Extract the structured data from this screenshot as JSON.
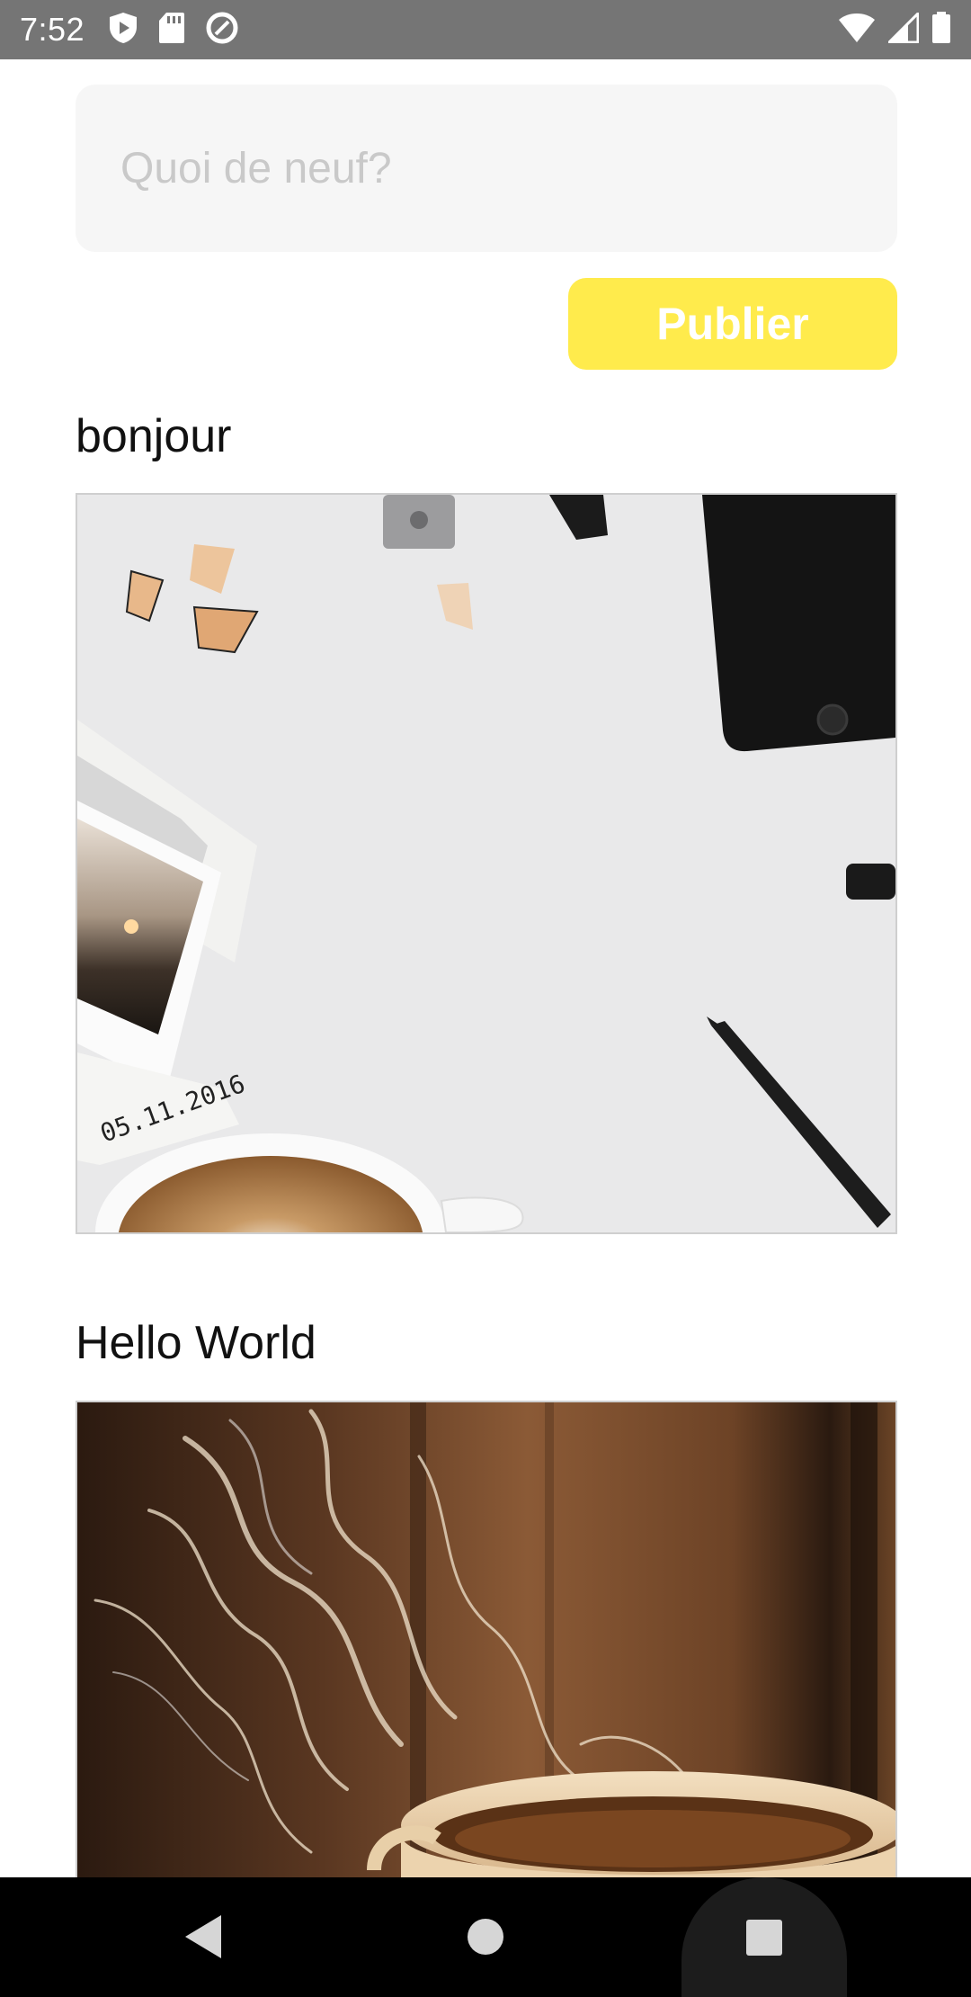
{
  "status_bar": {
    "time": "7:52",
    "left_icons": [
      "play-protect-icon",
      "sd-card-icon",
      "data-saver-icon"
    ],
    "right_icons": [
      "wifi-icon",
      "cell-signal-icon",
      "battery-icon"
    ]
  },
  "composer": {
    "placeholder": "Quoi de neuf?",
    "value": "",
    "publish_label": "Publier",
    "publish_color": "#ffeb4c"
  },
  "posts": [
    {
      "title": "bonjour",
      "image": "desk-flatlay-photo",
      "image_text": "05.11.2016"
    },
    {
      "title": "Hello World",
      "image": "steaming-coffee-photo"
    }
  ],
  "nav_bar": {
    "buttons": [
      "back-icon",
      "home-icon",
      "recents-icon"
    ]
  }
}
